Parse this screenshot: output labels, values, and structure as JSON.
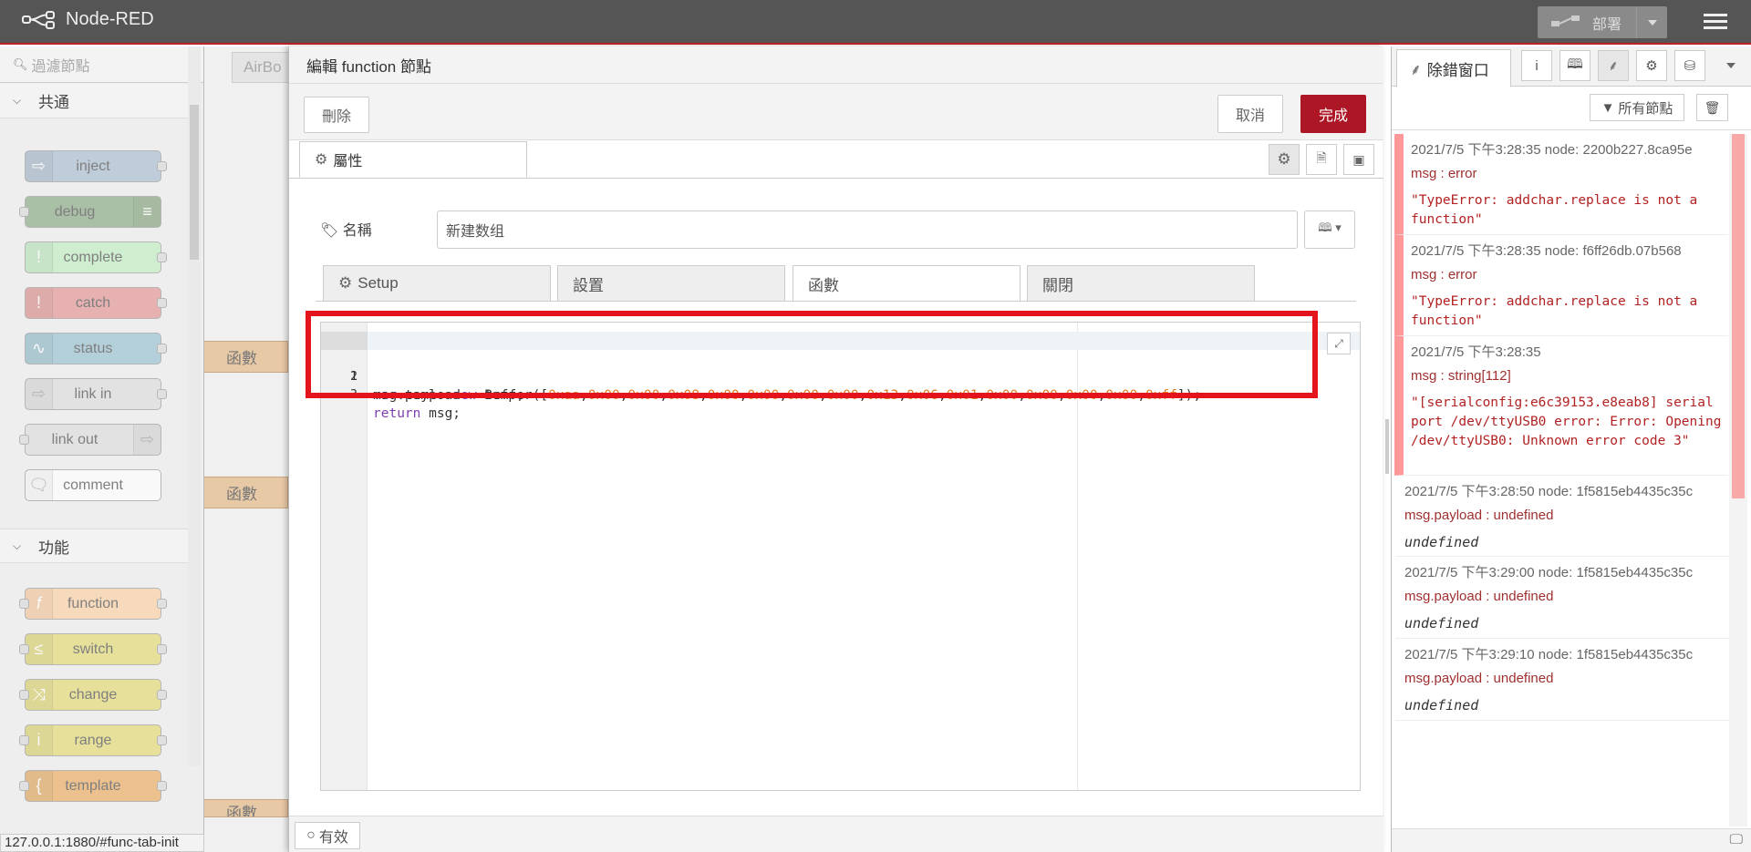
{
  "header": {
    "app_title": "Node-RED",
    "deploy_label": "部署"
  },
  "palette": {
    "filter_placeholder": "過濾節點",
    "categories": [
      {
        "label": "共通",
        "nodes": [
          "inject",
          "debug",
          "complete",
          "catch",
          "status",
          "link in",
          "link out",
          "comment"
        ]
      },
      {
        "label": "功能",
        "nodes": [
          "function",
          "switch",
          "change",
          "range",
          "template"
        ]
      }
    ]
  },
  "workspace": {
    "tab_label": "AirBo",
    "nodes": [
      "函數",
      "函數",
      "函數"
    ]
  },
  "editor": {
    "title": "編輯 function 節點",
    "delete_label": "刪除",
    "cancel_label": "取消",
    "done_label": "完成",
    "props_tab_label": "屬性",
    "name_label": "名稱",
    "name_value": "新建数组",
    "subtabs": [
      "Setup",
      "設置",
      "函數",
      "關閉"
    ],
    "active_subtab": "函數",
    "code_lines": [
      {
        "num": "1",
        "text": "var temp= new Buffer([0xaa,0x00,0x00,0x08,0x00,0x00,0x00,0x00,0x13,0x06,0x01,0x00,0x00,0x00,0x00,0xff]);"
      },
      {
        "num": "2",
        "text": "msg.payload = temp;"
      },
      {
        "num": "3",
        "text": "return msg;"
      }
    ],
    "enabled_label": "有效"
  },
  "sidebar": {
    "tab_label": "除錯窗口",
    "filter_label": "所有節點",
    "messages": [
      {
        "meta": "2021/7/5 下午3:28:35   node: 2200b227.8ca95e",
        "type": "msg : error",
        "value": "\"TypeError: addchar.replace is not a function\"",
        "error": true
      },
      {
        "meta": "2021/7/5 下午3:28:35   node: f6ff26db.07b568",
        "type": "msg : error",
        "value": "\"TypeError: addchar.replace is not a function\"",
        "error": true
      },
      {
        "meta": "2021/7/5 下午3:28:35",
        "type": "msg : string[112]",
        "value": "\"[serialconfig:e6c39153.e8eab8] serial port /dev/ttyUSB0 error: Error: Opening /dev/ttyUSB0: Unknown error code 3\"",
        "error": true
      },
      {
        "meta": "2021/7/5 下午3:28:50   node: 1f5815eb4435c35c",
        "type": "msg.payload : undefined",
        "value": "undefined",
        "error": false
      },
      {
        "meta": "2021/7/5 下午3:29:00   node: 1f5815eb4435c35c",
        "type": "msg.payload : undefined",
        "value": "undefined",
        "error": false
      },
      {
        "meta": "2021/7/5 下午3:29:10   node: 1f5815eb4435c35c",
        "type": "msg.payload : undefined",
        "value": "undefined",
        "error": false
      }
    ]
  },
  "status_bar": {
    "url": "127.0.0.1:1880/#func-tab-init"
  },
  "colors": {
    "accent": "#ad1625",
    "header": "#555555",
    "highlight": "#e4141c"
  }
}
